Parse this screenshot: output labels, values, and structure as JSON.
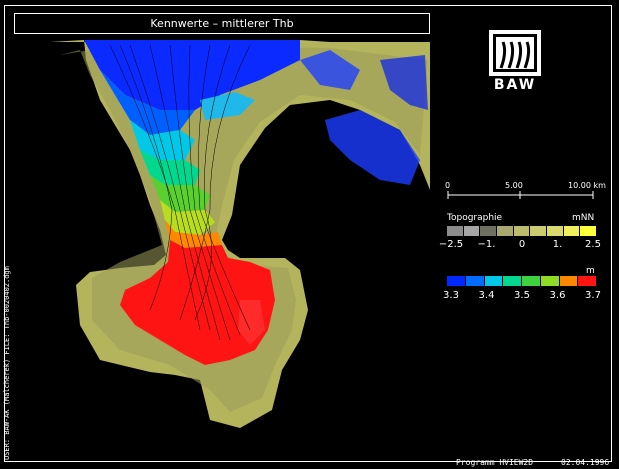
{
  "title": "Kennwerte – mittlerer Thb",
  "logo": {
    "text": "BAW"
  },
  "scale_bar": {
    "labels": [
      "0",
      "5.00",
      "10.00 km"
    ]
  },
  "topography_legend": {
    "title": "Topographie",
    "unit": "mNN",
    "colors": [
      "#8c8c8c",
      "#a5a5a5",
      "#707060",
      "#a8a870",
      "#bcbc6c",
      "#cbcb70",
      "#d9d96e",
      "#f0f05a",
      "#ffff3a"
    ],
    "tick_labels": [
      "−2.5",
      "−1.",
      "0",
      "1.",
      "2.5"
    ]
  },
  "water_legend": {
    "unit": "m",
    "colors": [
      "#0028ff",
      "#006cff",
      "#00c8e6",
      "#00d890",
      "#3ed240",
      "#8cdc28",
      "#ff8800",
      "#ff1414"
    ],
    "tick_labels": [
      "3.3",
      "3.4",
      "3.5",
      "3.6",
      "3.7"
    ]
  },
  "side_label": "USER: BAW-AK (Malcherek) FILE: Tnb-0020402.dgm",
  "footer": {
    "program": "Programm HVIEW2D",
    "date": "02.04.1996"
  }
}
